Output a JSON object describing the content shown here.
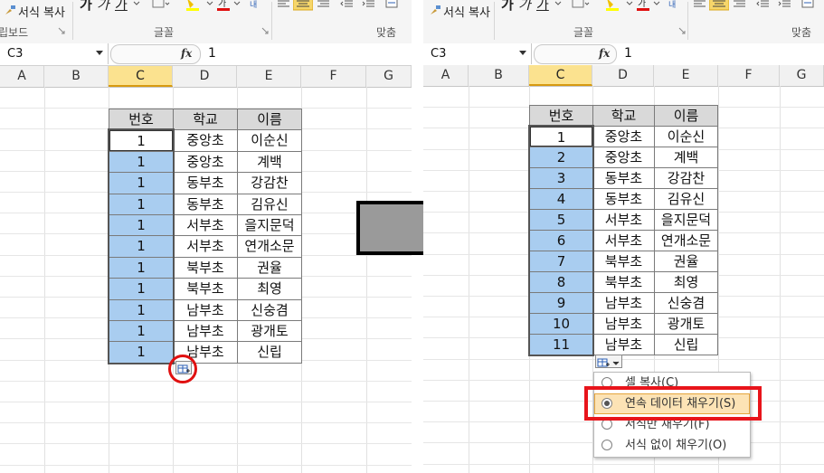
{
  "ribbon": {
    "format_painter": "서식 복사",
    "clipboard_group": "립보드",
    "font_group": "글꼴",
    "align_group": "맞춤",
    "bold": "가",
    "italic": "가",
    "underline": "가"
  },
  "formula_bar": {
    "name_box": "C3",
    "fx": "fx",
    "value": "1"
  },
  "columns": [
    "A",
    "B",
    "C",
    "D",
    "E",
    "F",
    "G"
  ],
  "table": {
    "headers": [
      "번호",
      "학교",
      "이름"
    ],
    "schools": [
      "중앙초",
      "중앙초",
      "동부초",
      "동부초",
      "서부초",
      "서부초",
      "북부초",
      "북부초",
      "남부초",
      "남부초",
      "남부초"
    ],
    "names": [
      "이순신",
      "계백",
      "강감찬",
      "김유신",
      "을지문덕",
      "연개소문",
      "권율",
      "최영",
      "신숭겸",
      "광개토",
      "신립"
    ],
    "numbers_before": [
      "1",
      "1",
      "1",
      "1",
      "1",
      "1",
      "1",
      "1",
      "1",
      "1",
      "1"
    ],
    "numbers_after": [
      "1",
      "2",
      "3",
      "4",
      "5",
      "6",
      "7",
      "8",
      "9",
      "10",
      "11"
    ]
  },
  "autofill_menu": {
    "items": [
      "셀 복사(C)",
      "연속 데이터 채우기(S)",
      "서식만 채우기(F)",
      "서식 없이 채우기(O)"
    ],
    "selected_index": 1
  },
  "colors": {
    "selection_fill": "#a9cdf0",
    "header_fill": "#d9d9d9",
    "highlight_red": "#e8141b",
    "arrow_gray": "#9a9a9a",
    "selected_column_header": "#fbe28f"
  },
  "icons": {
    "transition_arrow": "right-arrow-icon",
    "autofill_options": "auto-fill-options-icon"
  }
}
